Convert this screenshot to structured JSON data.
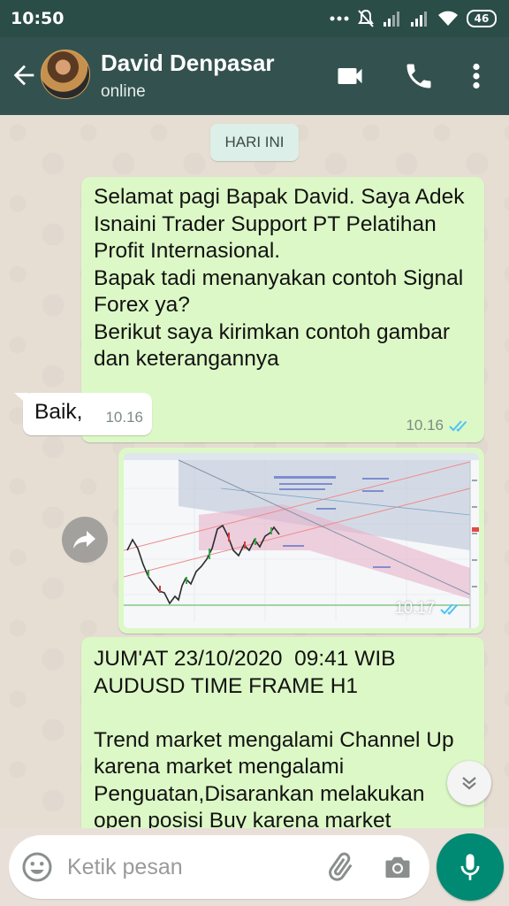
{
  "status_bar": {
    "time": "10:50",
    "battery": "46"
  },
  "header": {
    "contact_name": "David Denpasar",
    "contact_status": "online"
  },
  "chat": {
    "day_label": "HARI INI",
    "messages": [
      {
        "direction": "outgoing",
        "text": "Selamat pagi Bapak David. Saya Adek Isnaini Trader Support PT Pelatihan Profit Internasional.\nBapak tadi menanyakan contoh Signal Forex ya?\nBerikut saya kirimkan contoh gambar dan keterangannya",
        "time": "10.16",
        "status": "read"
      },
      {
        "direction": "incoming",
        "text": "Baik,",
        "time": "10.16"
      },
      {
        "direction": "outgoing",
        "type": "image",
        "time": "10.17",
        "status": "read"
      },
      {
        "direction": "outgoing",
        "text": "JUM'AT 23/10/2020  09:41 WIB\nAUDUSD TIME FRAME H1\n\nTrend market mengalami Channel Up karena market mengalami Penguatan,Disarankan melakukan open posisi Buy karena market"
      }
    ]
  },
  "input": {
    "placeholder": "Ketik pesan"
  },
  "colors": {
    "header": "#33524f",
    "status_bar": "#2b4d48",
    "outgoing_bubble": "#dcf8c6",
    "incoming_bubble": "#ffffff",
    "read_ticks": "#4fc3f7",
    "fab": "#008a73"
  },
  "icons": [
    "back-arrow-icon",
    "video-call-icon",
    "phone-icon",
    "more-vert-icon",
    "forward-icon",
    "chevron-down-icon",
    "emoji-icon",
    "attach-icon",
    "camera-icon",
    "mic-icon"
  ]
}
